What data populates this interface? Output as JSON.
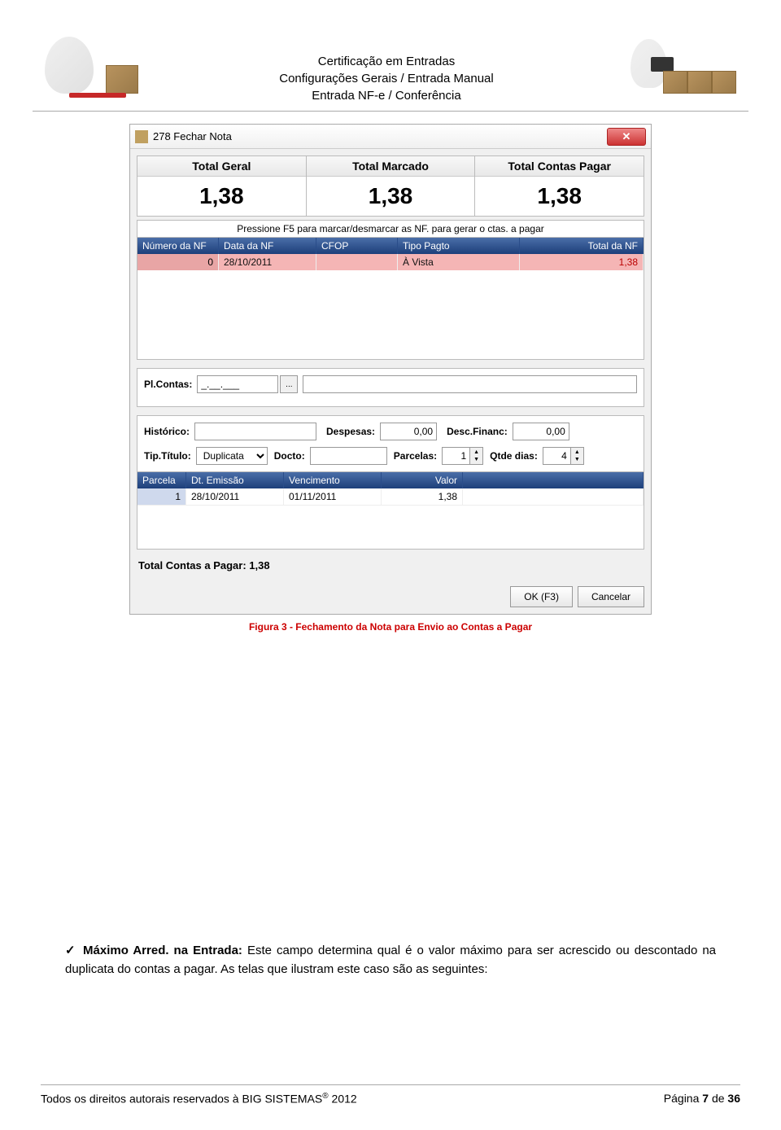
{
  "header": {
    "line1": "Certificação em Entradas",
    "line2": "Configurações Gerais / Entrada Manual",
    "line3": "Entrada NF-e / Conferência"
  },
  "window": {
    "title": "278 Fechar Nota",
    "close_symbol": "✕",
    "totals": {
      "col1_label": "Total Geral",
      "col1_value": "1,38",
      "col2_label": "Total Marcado",
      "col2_value": "1,38",
      "col3_label": "Total Contas Pagar",
      "col3_value": "1,38"
    },
    "hint": "Pressione F5 para marcar/desmarcar as NF. para gerar o ctas. a pagar",
    "grid1": {
      "headers": {
        "num": "Número da NF",
        "data": "Data da NF",
        "cfop": "CFOP",
        "tipo": "Tipo Pagto",
        "total": "Total da NF"
      },
      "row": {
        "num": "0",
        "data": "28/10/2011",
        "cfop": "",
        "tipo": "À Vista",
        "total": "1,38"
      }
    },
    "form": {
      "plcontas_label": "Pl.Contas:",
      "plcontas_value": "_.__.___",
      "plcontas_btn": "...",
      "historico_label": "Histórico:",
      "historico_value": "",
      "despesas_label": "Despesas:",
      "despesas_value": "0,00",
      "descfin_label": "Desc.Financ:",
      "descfin_value": "0,00",
      "tiptitulo_label": "Tip.Título:",
      "tiptitulo_value": "Duplicata",
      "docto_label": "Docto:",
      "docto_value": "",
      "parcelas_label": "Parcelas:",
      "parcelas_value": "1",
      "qtdedias_label": "Qtde dias:",
      "qtdedias_value": "4"
    },
    "grid2": {
      "headers": {
        "parcela": "Parcela",
        "emissao": "Dt. Emissão",
        "venc": "Vencimento",
        "valor": "Valor"
      },
      "row": {
        "parcela": "1",
        "emissao": "28/10/2011",
        "venc": "01/11/2011",
        "valor": "1,38"
      }
    },
    "total_pagar": "Total Contas a Pagar: 1,38",
    "ok_btn": "OK (F3)",
    "cancel_btn": "Cancelar"
  },
  "caption": "Figura 3 - Fechamento da Nota para Envio ao Contas a Pagar",
  "paragraph": {
    "check": "✓",
    "bold": "Máximo Arred. na Entrada:",
    "rest": " Este campo determina qual é o valor máximo para ser acrescido ou descontado na duplicata do contas a pagar. As telas que ilustram este caso são as seguintes:"
  },
  "footer": {
    "left_a": "Todos os direitos autorais reservados à BIG SISTEMAS",
    "left_reg": "®",
    "left_b": " 2012",
    "right_a": "Página ",
    "right_pg": "7",
    "right_b": " de ",
    "right_tot": "36"
  }
}
